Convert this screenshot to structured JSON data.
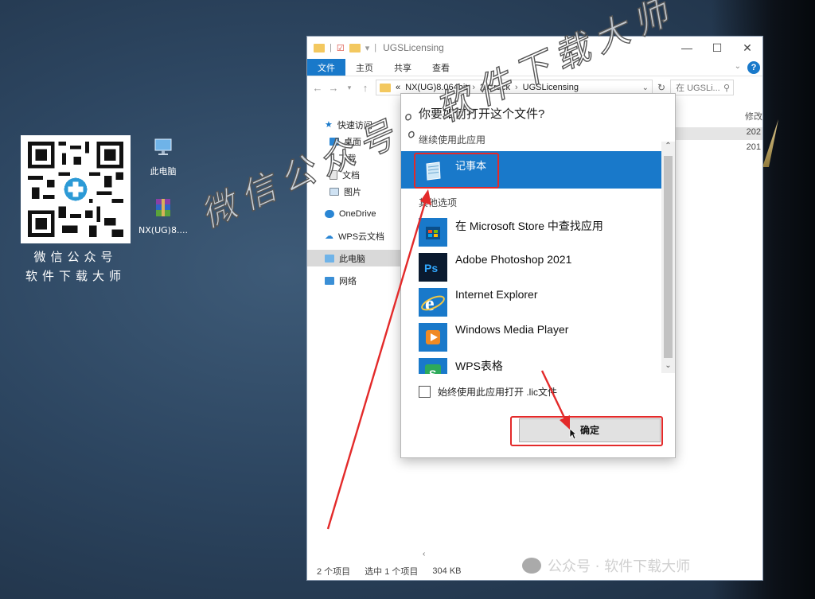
{
  "desktop": {
    "qr_caption_line1": "微信公众号",
    "qr_caption_line2": "软件下载大师",
    "icons": [
      {
        "label": "此电脑",
        "icon": "computer-icon"
      },
      {
        "label": "NX(UG)8....",
        "icon": "winrar-archive-icon"
      }
    ]
  },
  "explorer": {
    "title": "UGSLicensing",
    "ribbon_tabs": [
      "文件",
      "主页",
      "共享",
      "查看"
    ],
    "breadcrumb": [
      "NX(UG)8.064bit",
      "2.Crack",
      "UGSLicensing"
    ],
    "breadcrumb_prefix": "«",
    "search_placeholder": "在 UGSLi...",
    "nav_items": [
      {
        "label": "快速访问",
        "icon": "star-icon"
      },
      {
        "label": "桌面",
        "icon": "desktop-icon"
      },
      {
        "label": "下载",
        "icon": "download-icon"
      },
      {
        "label": "文档",
        "icon": "document-icon"
      },
      {
        "label": "图片",
        "icon": "picture-icon"
      },
      {
        "label": "OneDrive",
        "icon": "onedrive-icon"
      },
      {
        "label": "WPS云文档",
        "icon": "wps-cloud-icon"
      },
      {
        "label": "此电脑",
        "icon": "computer-icon"
      },
      {
        "label": "网络",
        "icon": "network-icon"
      }
    ],
    "column_header": "修改",
    "file_dates": [
      "202",
      "201"
    ],
    "status": {
      "count": "2 个项目",
      "selected": "选中 1 个项目",
      "size": "304 KB"
    }
  },
  "dialog": {
    "title": "你要如何打开这个文件?",
    "keep_using_label": "继续使用此应用",
    "current_app": {
      "name": "记事本",
      "icon": "notepad-icon"
    },
    "other_options_label": "其他选项",
    "apps": [
      {
        "name": "在 Microsoft Store 中查找应用",
        "icon": "microsoft-store-icon"
      },
      {
        "name": "Adobe Photoshop 2021",
        "icon": "photoshop-icon"
      },
      {
        "name": "Internet Explorer",
        "icon": "internet-explorer-icon"
      },
      {
        "name": "Windows Media Player",
        "icon": "media-player-icon"
      },
      {
        "name": "WPS表格",
        "icon": "wps-spreadsheet-icon"
      }
    ],
    "always_use_label": "始终使用此应用打开 .lic文件",
    "ok_label": "确定"
  },
  "watermark": {
    "diagonal": "微信公众号：软件下载大师",
    "bottom": "公众号 · 软件下载大师"
  },
  "colors": {
    "accent": "#1979ca",
    "annotation_red": "#e32a2a"
  }
}
